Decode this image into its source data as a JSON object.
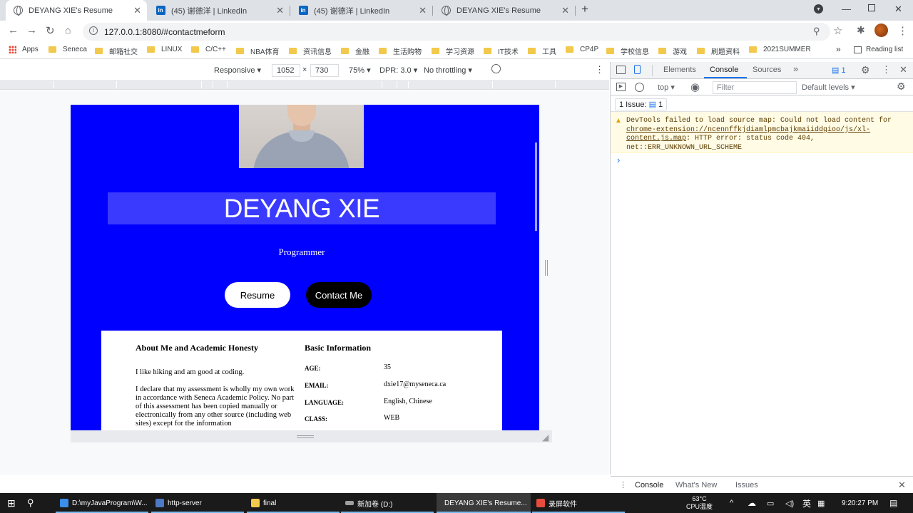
{
  "browser": {
    "tabs": [
      {
        "title": "DEYANG XIE's Resume",
        "icon": "globe-icon",
        "active": true
      },
      {
        "title": "(45) 谢德洋 | LinkedIn",
        "icon": "linkedin-icon",
        "active": false
      },
      {
        "title": "(45) 谢德洋 | LinkedIn",
        "icon": "linkedin-icon",
        "active": false
      },
      {
        "title": "DEYANG XIE's Resume",
        "icon": "globe-icon",
        "active": false
      }
    ],
    "new_tab": "+",
    "url": "127.0.0.1:8080/#contactmeform",
    "bookmarks": [
      "Apps",
      "Seneca",
      "邮箱社交",
      "LINUX",
      "C/C++",
      "NBA体育",
      "资讯信息",
      "金融",
      "生活购物",
      "学习资源",
      "IT技术",
      "工具",
      "CP4P",
      "学校信息",
      "游戏",
      "刷题资料",
      "2021SUMMER"
    ],
    "bookmarks_overflow": "»",
    "reading_list": "Reading list"
  },
  "device_toolbar": {
    "mode": "Responsive",
    "width": "1052",
    "times": "×",
    "height": "730",
    "zoom": "75%",
    "dpr": "DPR: 3.0",
    "throttling": "No throttling"
  },
  "page": {
    "name": "DEYANG XIE",
    "role": "Programmer",
    "buttons": {
      "resume": "Resume",
      "contact": "Contact Me"
    },
    "about_title": "About Me and Academic Honesty",
    "about_p1": "I like hiking and am good at coding.",
    "about_p2": "I declare that my assessment is wholly my own work in accordance with Seneca Academic Policy. No part of this assessment has been copied manually or electronically from any other source (including web sites) except for the information",
    "basic_title": "Basic Information",
    "info": [
      {
        "key": "AGE:",
        "value": "35"
      },
      {
        "key": "EMAIL:",
        "value": "dxie17@myseneca.ca"
      },
      {
        "key": "LANGUAGE:",
        "value": "English, Chinese"
      },
      {
        "key": "CLASS:",
        "value": "WEB"
      }
    ]
  },
  "devtools": {
    "tabs": [
      "Elements",
      "Console",
      "Sources",
      "»"
    ],
    "active_tab": "Console",
    "issue_badge": "1",
    "context": "top",
    "filter_placeholder": "Filter",
    "levels": "Default levels",
    "issues_count": "1 Issue:",
    "issues_badge": "1",
    "warning_prefix": "DevTools failed to load source map: Could not load content for ",
    "warning_link": "chrome-extension://ncennffkjdiamlpmcbajkmaiiddgioo/js/xl-content.js.map",
    "warning_suffix": ": HTTP error: status code 404, net::ERR_UNKNOWN_URL_SCHEME",
    "prompt": "›",
    "drawer_tabs": [
      "Console",
      "What's New",
      "Issues"
    ]
  },
  "taskbar": {
    "items": [
      {
        "label": "D:\\myJavaProgram\\W...",
        "color": "#3b8eea"
      },
      {
        "label": "http-server",
        "color": "#4e79c4"
      },
      {
        "label": "final",
        "color": "#f2c94c"
      },
      {
        "label": "新加卷 (D:)",
        "color": "#9e9e9e"
      },
      {
        "label": "DEYANG XIE's Resume...",
        "color": "#e8453c"
      },
      {
        "label": "录屏软件",
        "color": "#e84c3d"
      }
    ],
    "temp": "63°C",
    "temp_label": "CPU温度",
    "lang": "英",
    "time": "9:20:27 PM"
  },
  "colors": {
    "page_bg": "#0000ff",
    "banner": "#3a3aff",
    "accent": "#1a73e8"
  }
}
